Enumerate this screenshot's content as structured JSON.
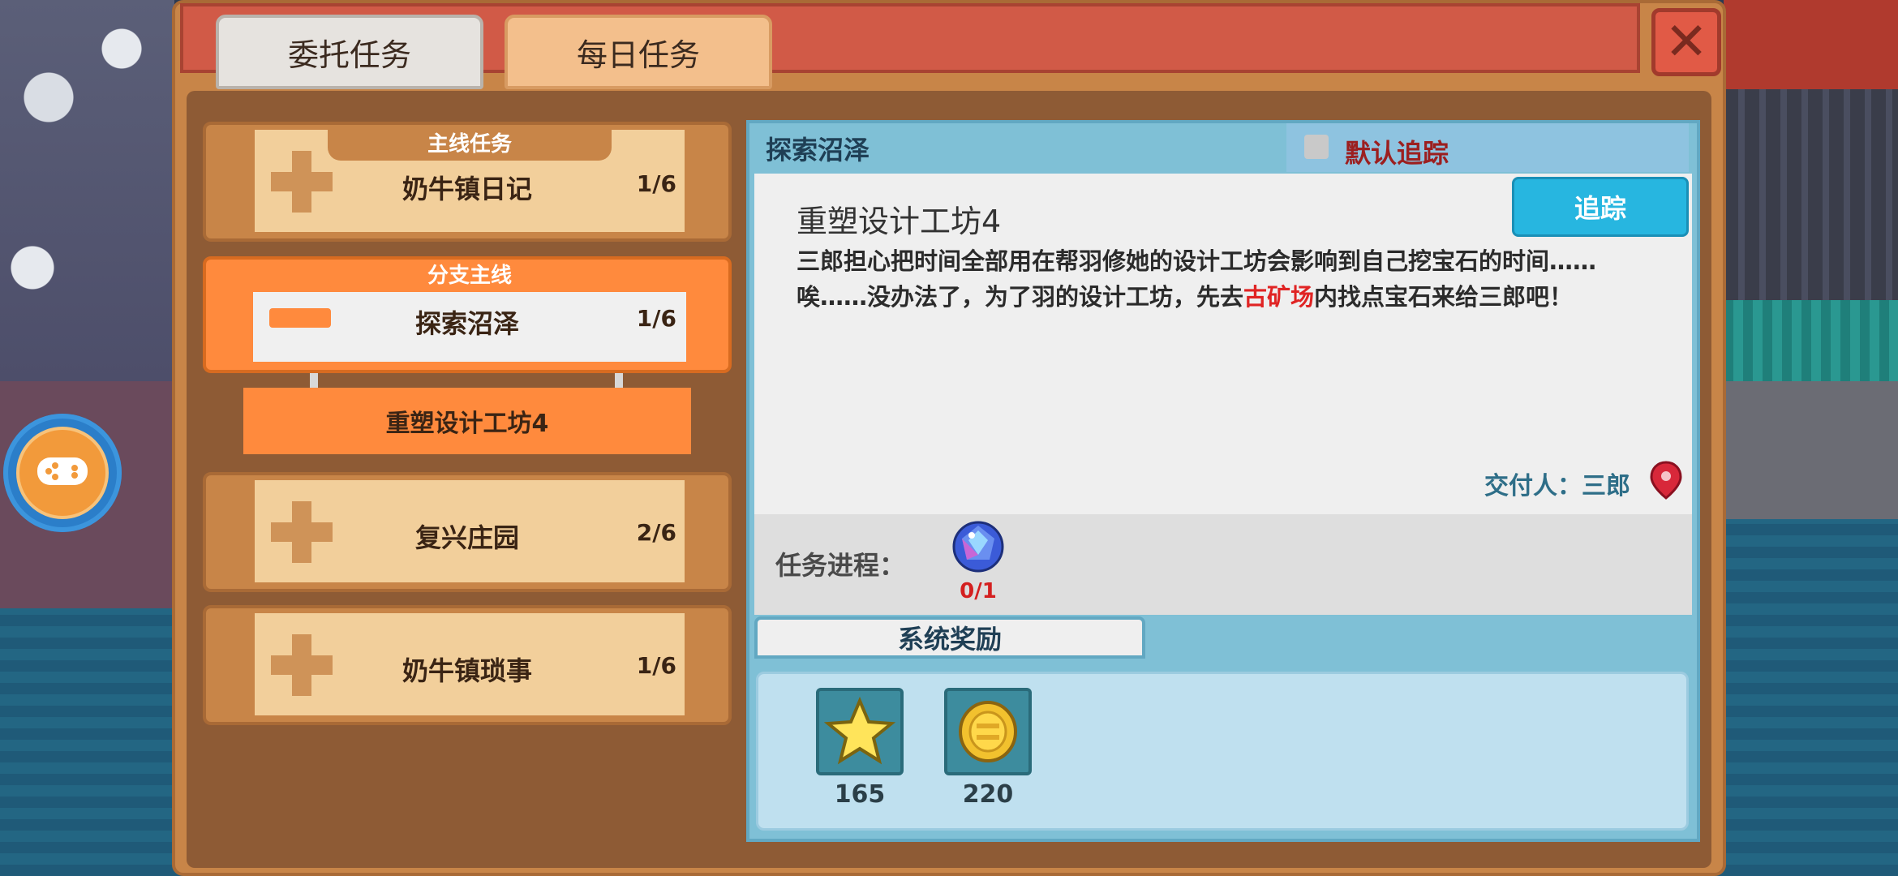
{
  "tabs": {
    "commission": "委托任务",
    "daily": "每日任务"
  },
  "quest_list": {
    "main": {
      "tag": "主线任务",
      "name": "奶牛镇日记",
      "progress": "1/6"
    },
    "branch": {
      "tag": "分支主线",
      "name": "探索沼泽",
      "progress": "1/6",
      "sub_quest": "重塑设计工坊4"
    },
    "revive": {
      "name": "复兴庄园",
      "progress": "2/6"
    },
    "chores": {
      "name": "奶牛镇琐事",
      "progress": "1/6"
    }
  },
  "detail": {
    "chapter": "探索沼泽",
    "default_track_label": "默认追踪",
    "default_track_checked": false,
    "track_button": "追踪",
    "title": "重塑设计工坊4",
    "desc_line1": "三郎担心把时间全部用在帮羽修她的设计工坊会影响到自己挖宝石的时间……",
    "desc_line2_pre": "唉……没办法了，为了羽的设计工坊，先去",
    "desc_highlight": "古矿场",
    "desc_line2_post": "内找点宝石来给三郎吧！",
    "giver": "交付人：三郎",
    "progress_label": "任务进程：",
    "progress_count": "0/1",
    "reward_tab": "系统奖励",
    "rewards": [
      {
        "icon": "star-icon",
        "value": "165"
      },
      {
        "icon": "gold-coin-icon",
        "value": "220"
      }
    ]
  },
  "colors": {
    "frame": "#c88548",
    "accent_orange": "#ff8a3d",
    "header_red": "#d15a47",
    "detail_blue": "#7fc0d6",
    "highlight_red": "#e02424",
    "track_button": "#27b6e0"
  }
}
